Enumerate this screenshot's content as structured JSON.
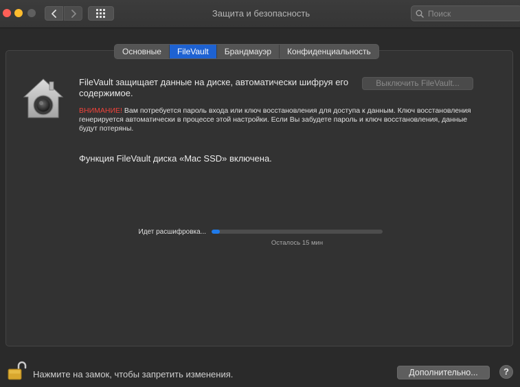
{
  "window": {
    "title": "Защита и безопасность",
    "search_placeholder": "Поиск"
  },
  "tabs": [
    {
      "label": "Основные",
      "active": false
    },
    {
      "label": "FileVault",
      "active": true
    },
    {
      "label": "Брандмауэр",
      "active": false
    },
    {
      "label": "Конфиденциальность",
      "active": false
    }
  ],
  "filevault": {
    "description": "FileVault защищает данные на диске, автоматически шифруя его содержимое.",
    "turn_off_button": "Выключить FileVault...",
    "warning_label": "ВНИМАНИЕ!",
    "warning_text": " Вам потребуется пароль входа или ключ восстановления для доступа к данным. Ключ восстановления генерируется автоматически в процессе этой настройки. Если Вы забудете пароль и ключ восстановления, данные будут потеряны.",
    "status": "Функция FileVault диска «Mac SSD» включена.",
    "progress_label": "Идет расшифровка...",
    "progress_fraction": 0.05,
    "remaining": "Осталось 15 мин"
  },
  "footer": {
    "lock_text": "Нажмите на замок, чтобы запретить изменения.",
    "advanced_button": "Дополнительно...",
    "help_label": "?"
  },
  "colors": {
    "accent": "#1e62d2",
    "progress": "#1f7aea",
    "warning": "#f0433a"
  }
}
